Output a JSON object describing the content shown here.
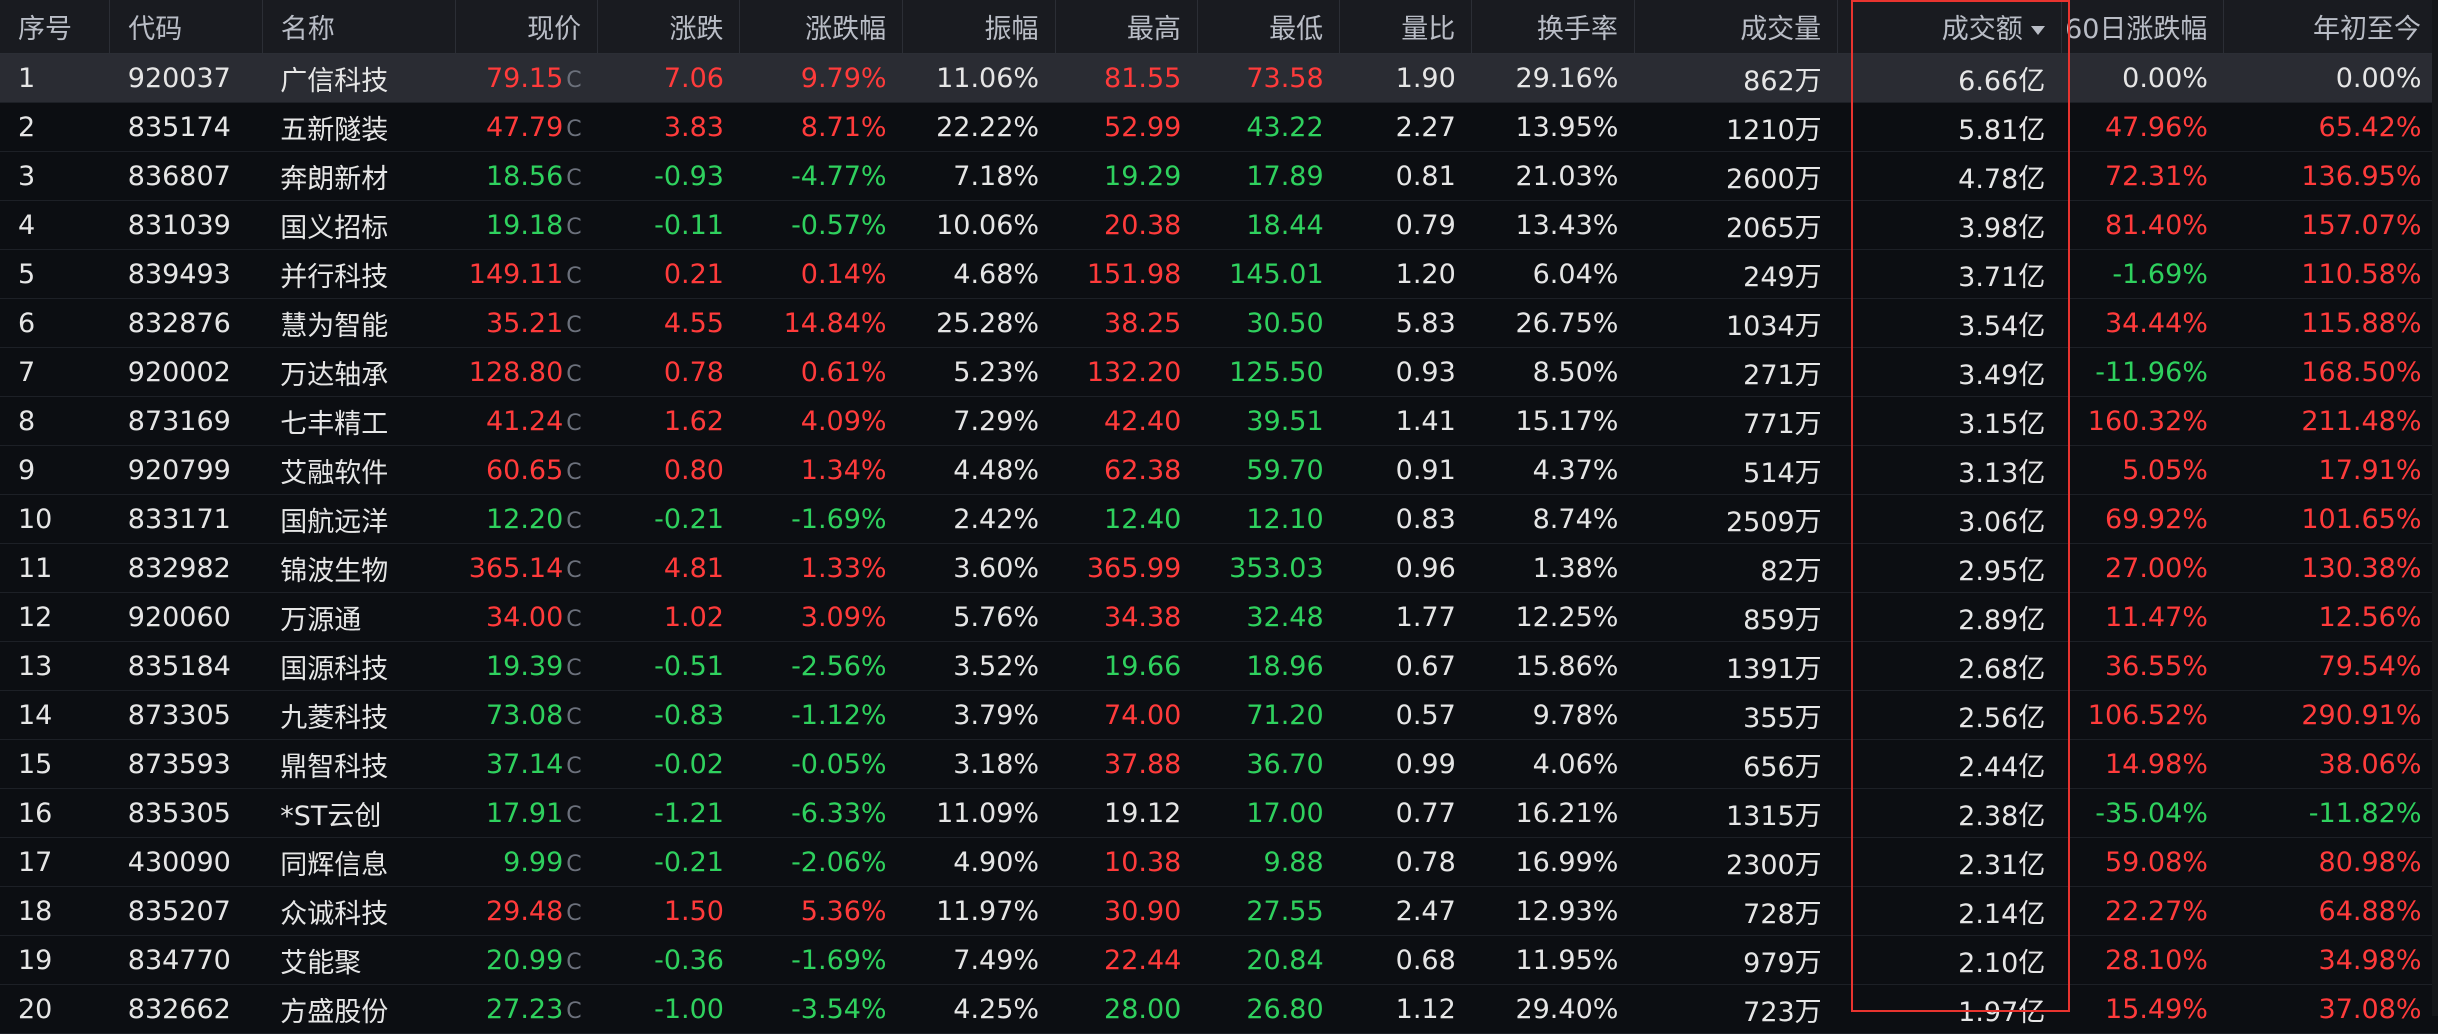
{
  "columns": [
    {
      "key": "seq",
      "label": "序号",
      "align": "l"
    },
    {
      "key": "code",
      "label": "代码",
      "align": "l"
    },
    {
      "key": "name",
      "label": "名称",
      "align": "l"
    },
    {
      "key": "price",
      "label": "现价",
      "align": "r"
    },
    {
      "key": "chg",
      "label": "涨跌",
      "align": "r"
    },
    {
      "key": "pct",
      "label": "涨跌幅",
      "align": "r"
    },
    {
      "key": "amp",
      "label": "振幅",
      "align": "r"
    },
    {
      "key": "high",
      "label": "最高",
      "align": "r"
    },
    {
      "key": "low",
      "label": "最低",
      "align": "r"
    },
    {
      "key": "vr",
      "label": "量比",
      "align": "r"
    },
    {
      "key": "turn",
      "label": "换手率",
      "align": "r"
    },
    {
      "key": "vol",
      "label": "成交量",
      "align": "r"
    },
    {
      "key": "amt",
      "label": "成交额",
      "align": "r",
      "sorted": true
    },
    {
      "key": "d60",
      "label": "60日涨跌幅",
      "align": "r"
    },
    {
      "key": "ytd",
      "label": "年初至今",
      "align": "r"
    }
  ],
  "price_tag": "C",
  "selected_row": 0,
  "colors": {
    "up": "#ff3b3b",
    "down": "#2fd15e",
    "flat": "#e6e6e6",
    "highlight_box": "#e8342f"
  },
  "sort_icon": "caret-down-icon",
  "rows": [
    {
      "seq": "1",
      "code": "920037",
      "name": "广信科技",
      "price": "79.15",
      "chg": "7.06",
      "pct": "9.79%",
      "amp": "11.06%",
      "high": "81.55",
      "low": "73.58",
      "vr": "1.90",
      "turn": "29.16%",
      "vol": "862万",
      "amt": "6.66亿",
      "d60": "0.00%",
      "ytd": "0.00%"
    },
    {
      "seq": "2",
      "code": "835174",
      "name": "五新隧装",
      "price": "47.79",
      "chg": "3.83",
      "pct": "8.71%",
      "amp": "22.22%",
      "high": "52.99",
      "low": "43.22",
      "vr": "2.27",
      "turn": "13.95%",
      "vol": "1210万",
      "amt": "5.81亿",
      "d60": "47.96%",
      "ytd": "65.42%"
    },
    {
      "seq": "3",
      "code": "836807",
      "name": "奔朗新材",
      "price": "18.56",
      "chg": "-0.93",
      "pct": "-4.77%",
      "amp": "7.18%",
      "high": "19.29",
      "low": "17.89",
      "vr": "0.81",
      "turn": "21.03%",
      "vol": "2600万",
      "amt": "4.78亿",
      "d60": "72.31%",
      "ytd": "136.95%"
    },
    {
      "seq": "4",
      "code": "831039",
      "name": "国义招标",
      "price": "19.18",
      "chg": "-0.11",
      "pct": "-0.57%",
      "amp": "10.06%",
      "high": "20.38",
      "low": "18.44",
      "vr": "0.79",
      "turn": "13.43%",
      "vol": "2065万",
      "amt": "3.98亿",
      "d60": "81.40%",
      "ytd": "157.07%"
    },
    {
      "seq": "5",
      "code": "839493",
      "name": "并行科技",
      "price": "149.11",
      "chg": "0.21",
      "pct": "0.14%",
      "amp": "4.68%",
      "high": "151.98",
      "low": "145.01",
      "vr": "1.20",
      "turn": "6.04%",
      "vol": "249万",
      "amt": "3.71亿",
      "d60": "-1.69%",
      "ytd": "110.58%"
    },
    {
      "seq": "6",
      "code": "832876",
      "name": "慧为智能",
      "price": "35.21",
      "chg": "4.55",
      "pct": "14.84%",
      "amp": "25.28%",
      "high": "38.25",
      "low": "30.50",
      "vr": "5.83",
      "turn": "26.75%",
      "vol": "1034万",
      "amt": "3.54亿",
      "d60": "34.44%",
      "ytd": "115.88%"
    },
    {
      "seq": "7",
      "code": "920002",
      "name": "万达轴承",
      "price": "128.80",
      "chg": "0.78",
      "pct": "0.61%",
      "amp": "5.23%",
      "high": "132.20",
      "low": "125.50",
      "vr": "0.93",
      "turn": "8.50%",
      "vol": "271万",
      "amt": "3.49亿",
      "d60": "-11.96%",
      "ytd": "168.50%"
    },
    {
      "seq": "8",
      "code": "873169",
      "name": "七丰精工",
      "price": "41.24",
      "chg": "1.62",
      "pct": "4.09%",
      "amp": "7.29%",
      "high": "42.40",
      "low": "39.51",
      "vr": "1.41",
      "turn": "15.17%",
      "vol": "771万",
      "amt": "3.15亿",
      "d60": "160.32%",
      "ytd": "211.48%"
    },
    {
      "seq": "9",
      "code": "920799",
      "name": "艾融软件",
      "price": "60.65",
      "chg": "0.80",
      "pct": "1.34%",
      "amp": "4.48%",
      "high": "62.38",
      "low": "59.70",
      "vr": "0.91",
      "turn": "4.37%",
      "vol": "514万",
      "amt": "3.13亿",
      "d60": "5.05%",
      "ytd": "17.91%"
    },
    {
      "seq": "10",
      "code": "833171",
      "name": "国航远洋",
      "price": "12.20",
      "chg": "-0.21",
      "pct": "-1.69%",
      "amp": "2.42%",
      "high": "12.40",
      "low": "12.10",
      "vr": "0.83",
      "turn": "8.74%",
      "vol": "2509万",
      "amt": "3.06亿",
      "d60": "69.92%",
      "ytd": "101.65%"
    },
    {
      "seq": "11",
      "code": "832982",
      "name": "锦波生物",
      "price": "365.14",
      "chg": "4.81",
      "pct": "1.33%",
      "amp": "3.60%",
      "high": "365.99",
      "low": "353.03",
      "vr": "0.96",
      "turn": "1.38%",
      "vol": "82万",
      "amt": "2.95亿",
      "d60": "27.00%",
      "ytd": "130.38%"
    },
    {
      "seq": "12",
      "code": "920060",
      "name": "万源通",
      "price": "34.00",
      "chg": "1.02",
      "pct": "3.09%",
      "amp": "5.76%",
      "high": "34.38",
      "low": "32.48",
      "vr": "1.77",
      "turn": "12.25%",
      "vol": "859万",
      "amt": "2.89亿",
      "d60": "11.47%",
      "ytd": "12.56%"
    },
    {
      "seq": "13",
      "code": "835184",
      "name": "国源科技",
      "price": "19.39",
      "chg": "-0.51",
      "pct": "-2.56%",
      "amp": "3.52%",
      "high": "19.66",
      "low": "18.96",
      "vr": "0.67",
      "turn": "15.86%",
      "vol": "1391万",
      "amt": "2.68亿",
      "d60": "36.55%",
      "ytd": "79.54%"
    },
    {
      "seq": "14",
      "code": "873305",
      "name": "九菱科技",
      "price": "73.08",
      "chg": "-0.83",
      "pct": "-1.12%",
      "amp": "3.79%",
      "high": "74.00",
      "low": "71.20",
      "vr": "0.57",
      "turn": "9.78%",
      "vol": "355万",
      "amt": "2.56亿",
      "d60": "106.52%",
      "ytd": "290.91%"
    },
    {
      "seq": "15",
      "code": "873593",
      "name": "鼎智科技",
      "price": "37.14",
      "chg": "-0.02",
      "pct": "-0.05%",
      "amp": "3.18%",
      "high": "37.88",
      "low": "36.70",
      "vr": "0.99",
      "turn": "4.06%",
      "vol": "656万",
      "amt": "2.44亿",
      "d60": "14.98%",
      "ytd": "38.06%"
    },
    {
      "seq": "16",
      "code": "835305",
      "name": "*ST云创",
      "price": "17.91",
      "chg": "-1.21",
      "pct": "-6.33%",
      "amp": "11.09%",
      "high": "19.12",
      "low": "17.00",
      "vr": "0.77",
      "turn": "16.21%",
      "vol": "1315万",
      "amt": "2.38亿",
      "d60": "-35.04%",
      "ytd": "-11.82%"
    },
    {
      "seq": "17",
      "code": "430090",
      "name": "同辉信息",
      "price": "9.99",
      "chg": "-0.21",
      "pct": "-2.06%",
      "amp": "4.90%",
      "high": "10.38",
      "low": "9.88",
      "vr": "0.78",
      "turn": "16.99%",
      "vol": "2300万",
      "amt": "2.31亿",
      "d60": "59.08%",
      "ytd": "80.98%"
    },
    {
      "seq": "18",
      "code": "835207",
      "name": "众诚科技",
      "price": "29.48",
      "chg": "1.50",
      "pct": "5.36%",
      "amp": "11.97%",
      "high": "30.90",
      "low": "27.55",
      "vr": "2.47",
      "turn": "12.93%",
      "vol": "728万",
      "amt": "2.14亿",
      "d60": "22.27%",
      "ytd": "64.88%"
    },
    {
      "seq": "19",
      "code": "834770",
      "name": "艾能聚",
      "price": "20.99",
      "chg": "-0.36",
      "pct": "-1.69%",
      "amp": "7.49%",
      "high": "22.44",
      "low": "20.84",
      "vr": "0.68",
      "turn": "11.95%",
      "vol": "979万",
      "amt": "2.10亿",
      "d60": "28.10%",
      "ytd": "34.98%"
    },
    {
      "seq": "20",
      "code": "832662",
      "name": "方盛股份",
      "price": "27.23",
      "chg": "-1.00",
      "pct": "-3.54%",
      "amp": "4.25%",
      "high": "28.00",
      "low": "26.80",
      "vr": "1.12",
      "turn": "29.40%",
      "vol": "723万",
      "amt": "1.97亿",
      "d60": "15.49%",
      "ytd": "37.08%"
    }
  ]
}
